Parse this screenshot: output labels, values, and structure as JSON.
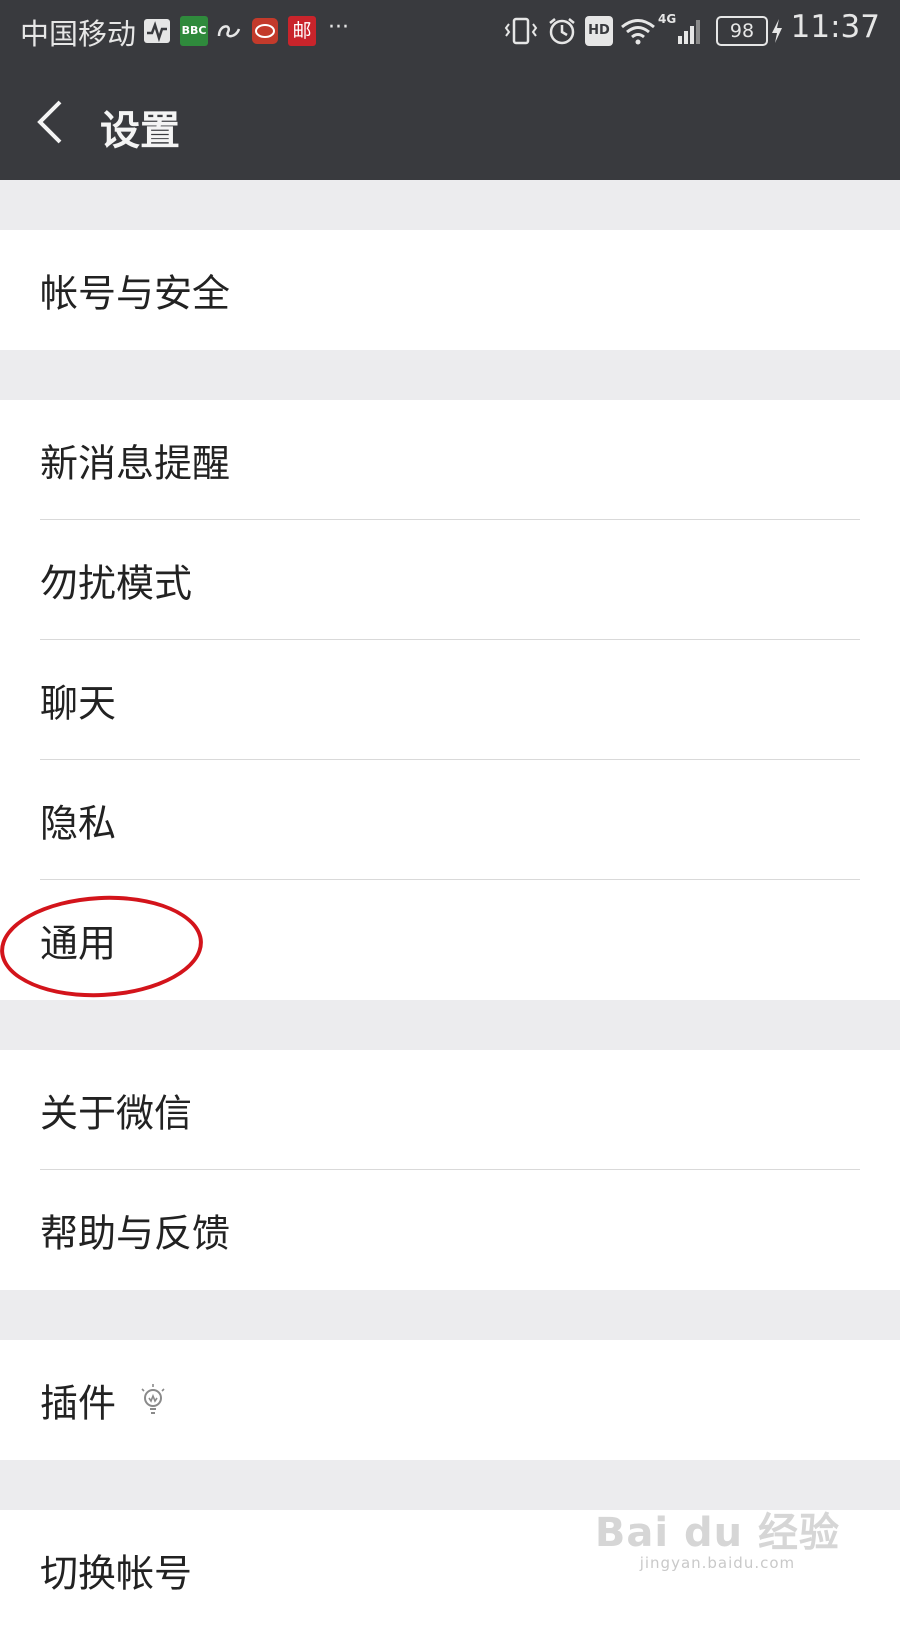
{
  "status_bar": {
    "carrier": "中国移动",
    "bbc_badge": "BBC",
    "mail_badge": "邮",
    "more": "···",
    "hd_badge": "HD",
    "network": "4G",
    "battery": "98",
    "time": "11:37"
  },
  "header": {
    "back_icon": "chevron-left-icon",
    "title": "设置"
  },
  "groups": [
    {
      "items": [
        {
          "label": "帐号与安全"
        }
      ]
    },
    {
      "items": [
        {
          "label": "新消息提醒"
        },
        {
          "label": "勿扰模式"
        },
        {
          "label": "聊天"
        },
        {
          "label": "隐私"
        },
        {
          "label": "通用"
        }
      ]
    },
    {
      "items": [
        {
          "label": "关于微信"
        },
        {
          "label": "帮助与反馈"
        }
      ]
    },
    {
      "items": [
        {
          "label": "插件",
          "icon": "lightbulb-icon"
        }
      ]
    },
    {
      "items": [
        {
          "label": "切换帐号"
        }
      ]
    }
  ],
  "annotation": {
    "highlighted_item": "通用",
    "color": "#d3141b"
  },
  "watermark": {
    "main": "Bai du 经验",
    "sub": "jingyan.baidu.com"
  },
  "colors": {
    "header_bg": "#393a3e",
    "page_bg": "#ececee",
    "row_bg": "#ffffff"
  }
}
